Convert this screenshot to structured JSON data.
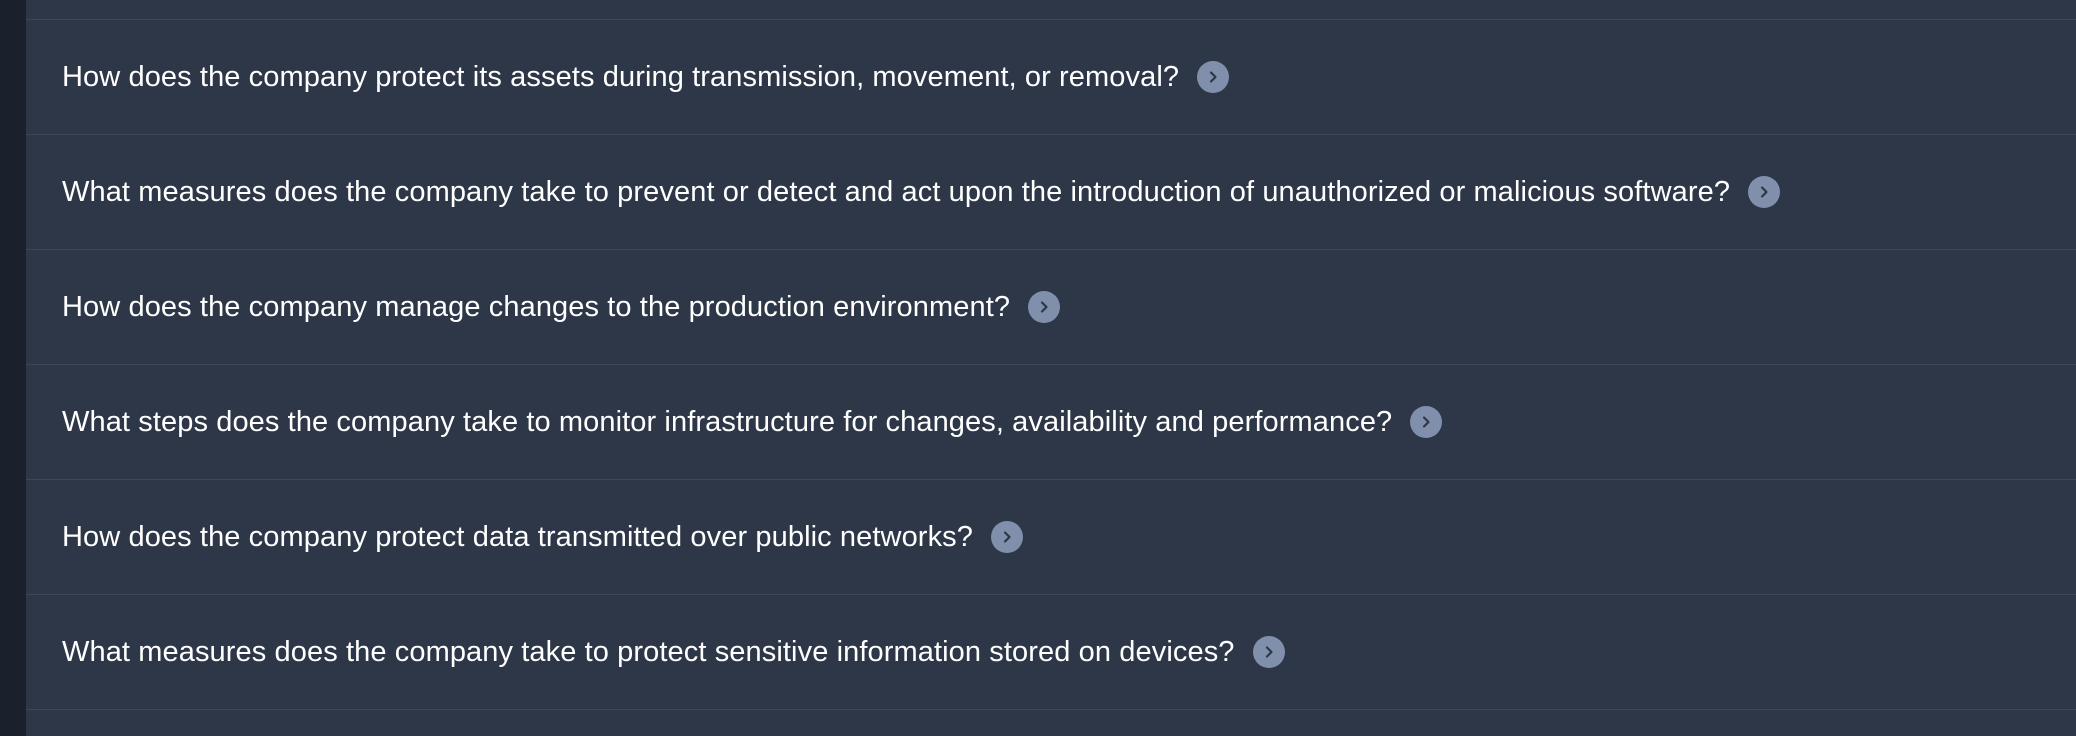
{
  "faq": {
    "items": [
      {
        "question": "How does the company protect its assets during transmission, movement, or removal?",
        "icon": "chevron-right-circle-icon"
      },
      {
        "question": "What measures does the company take to prevent or detect and act upon the introduction of unauthorized or malicious software?",
        "icon": "chevron-right-circle-icon"
      },
      {
        "question": "How does the company manage changes to the production environment?",
        "icon": "chevron-right-circle-icon"
      },
      {
        "question": "What steps does the company take to monitor infrastructure for changes, availability and performance?",
        "icon": "chevron-right-circle-icon"
      },
      {
        "question": "How does the company protect data transmitted over public networks?",
        "icon": "chevron-right-circle-icon"
      },
      {
        "question": "What measures does the company take to protect sensitive information stored on devices?",
        "icon": "chevron-right-circle-icon"
      }
    ]
  },
  "colors": {
    "background": "#2d3748",
    "left_strip": "#1a202c",
    "divider": "#3c4759",
    "text": "#ffffff",
    "chevron_circle": "#8090ac",
    "chevron_glyph": "#2d3748"
  }
}
